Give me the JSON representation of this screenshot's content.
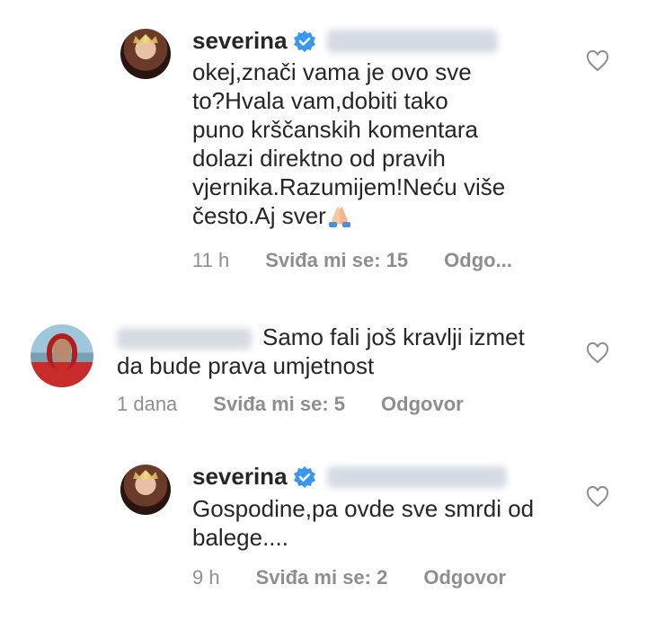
{
  "comments": [
    {
      "username": "severina",
      "text_lines": [
        "okej,znači vama je ovo sve",
        "to?Hvala vam,dobiti tako",
        "puno krščanskih komentara",
        "dolazi direktno od pravih",
        "vjernika.Razumijem!Neću više",
        "često.Aj sver"
      ],
      "time": "11 h",
      "likes": "Sviđa mi se: 15",
      "reply": "Odgo..."
    },
    {
      "text_lines": [
        "Samo fali još kravlji izmet",
        "da bude prava umjetnost"
      ],
      "time": "1 dana",
      "likes": "Sviđa mi se: 5",
      "reply": "Odgovor"
    },
    {
      "username": "severina",
      "text_lines": [
        "Gospodine,pa ovde sve smrdi od",
        "balege...."
      ],
      "time": "9 h",
      "likes": "Sviđa mi se: 2",
      "reply": "Odgovor"
    }
  ],
  "colors": {
    "verified": "#3897f0",
    "meta": "#8e8e8e",
    "text": "#262626"
  }
}
